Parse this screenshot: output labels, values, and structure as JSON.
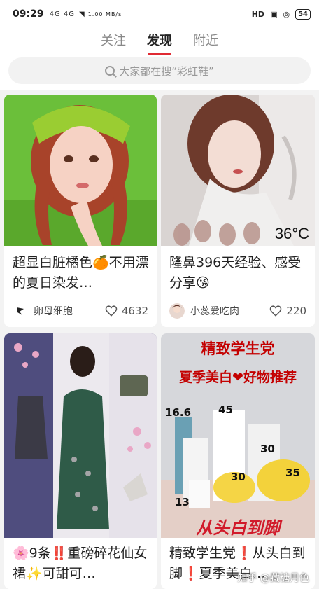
{
  "status": {
    "time": "09:29",
    "signal": "4G 4G",
    "speed": "1.00 MB/s",
    "hd": "HD",
    "battery": "54"
  },
  "tabs": [
    {
      "label": "关注"
    },
    {
      "label": "发现",
      "active": true
    },
    {
      "label": "附近"
    }
  ],
  "search": {
    "placeholder": "大家都在搜“彩虹鞋”"
  },
  "cards": [
    {
      "title": "超显白脏橘色🍊不用漂的夏日染发…",
      "author": "卵母细胞",
      "likes": "4632"
    },
    {
      "title": "隆鼻396天经验、感受分享😘",
      "author": "小蕊爱吃肉",
      "likes": "220",
      "overlay": "36°C"
    },
    {
      "title": "🌸9条‼️重磅碎花仙女裙✨可甜可…",
      "author": "",
      "likes": ""
    },
    {
      "title": "精致学生党❗从头白到脚❗夏季美白…",
      "author": "",
      "likes": "",
      "banner1": "精致学生党",
      "banner2": "夏季美白❤好物推荐",
      "slogan": "从头白到脚",
      "prices": [
        "16.6",
        "45",
        "30",
        "30",
        "35",
        "13"
      ]
    }
  ],
  "watermark": "知乎 @藏糖月色",
  "colors": {
    "accent": "#e02a33"
  }
}
